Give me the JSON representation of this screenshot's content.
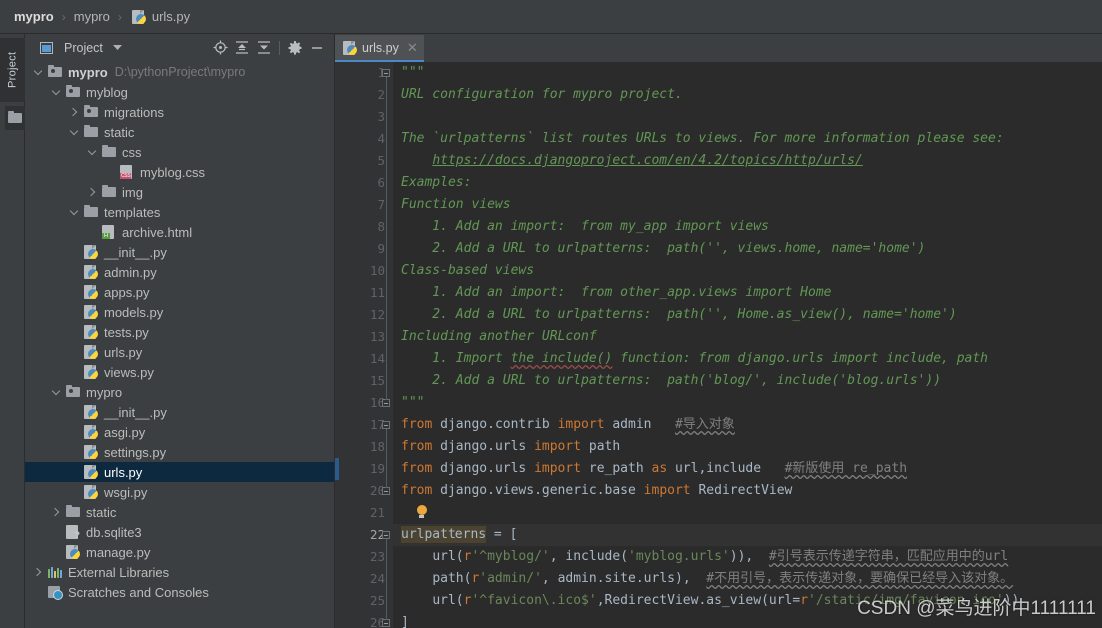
{
  "breadcrumb": {
    "items": [
      {
        "label": "mypro",
        "bold": true
      },
      {
        "label": "mypro",
        "bold": false
      },
      {
        "label": "urls.py",
        "bold": false,
        "icon": "python-file-icon"
      }
    ],
    "separator": "›"
  },
  "tool_strip": {
    "label": "Project",
    "icon": "project-folder-icon"
  },
  "project_panel": {
    "title": "Project",
    "dropdown_icon": "chevron-down-icon",
    "toolbar_icons": [
      "select-opened-file-icon",
      "expand-all-icon",
      "collapse-all-icon",
      "settings-gear-icon",
      "hide-panel-icon"
    ],
    "tree": [
      {
        "depth": 0,
        "arrow": "down",
        "icon": "folder-module-icon",
        "label": "mypro",
        "bold": true,
        "path": "D:\\pythonProject\\mypro",
        "selected": false
      },
      {
        "depth": 1,
        "arrow": "down",
        "icon": "folder-source-icon",
        "label": "myblog",
        "selected": false
      },
      {
        "depth": 2,
        "arrow": "right",
        "icon": "folder-source-icon",
        "label": "migrations",
        "selected": false
      },
      {
        "depth": 2,
        "arrow": "down",
        "icon": "folder-icon",
        "label": "static",
        "selected": false
      },
      {
        "depth": 3,
        "arrow": "down",
        "icon": "folder-icon",
        "label": "css",
        "selected": false
      },
      {
        "depth": 4,
        "arrow": "none",
        "icon": "css-file-icon",
        "label": "myblog.css",
        "selected": false
      },
      {
        "depth": 3,
        "arrow": "right",
        "icon": "folder-icon",
        "label": "img",
        "selected": false
      },
      {
        "depth": 2,
        "arrow": "down",
        "icon": "folder-icon",
        "label": "templates",
        "selected": false
      },
      {
        "depth": 3,
        "arrow": "none",
        "icon": "html-file-icon",
        "label": "archive.html",
        "selected": false
      },
      {
        "depth": 2,
        "arrow": "none",
        "icon": "python-file-icon",
        "label": "__init__.py",
        "selected": false
      },
      {
        "depth": 2,
        "arrow": "none",
        "icon": "python-file-icon",
        "label": "admin.py",
        "selected": false
      },
      {
        "depth": 2,
        "arrow": "none",
        "icon": "python-file-icon",
        "label": "apps.py",
        "selected": false
      },
      {
        "depth": 2,
        "arrow": "none",
        "icon": "python-file-icon",
        "label": "models.py",
        "selected": false
      },
      {
        "depth": 2,
        "arrow": "none",
        "icon": "python-file-icon",
        "label": "tests.py",
        "selected": false
      },
      {
        "depth": 2,
        "arrow": "none",
        "icon": "python-file-icon",
        "label": "urls.py",
        "selected": false
      },
      {
        "depth": 2,
        "arrow": "none",
        "icon": "python-file-icon",
        "label": "views.py",
        "selected": false
      },
      {
        "depth": 1,
        "arrow": "down",
        "icon": "folder-source-icon",
        "label": "mypro",
        "selected": false
      },
      {
        "depth": 2,
        "arrow": "none",
        "icon": "python-file-icon",
        "label": "__init__.py",
        "selected": false
      },
      {
        "depth": 2,
        "arrow": "none",
        "icon": "python-file-icon",
        "label": "asgi.py",
        "selected": false
      },
      {
        "depth": 2,
        "arrow": "none",
        "icon": "python-file-icon",
        "label": "settings.py",
        "selected": false
      },
      {
        "depth": 2,
        "arrow": "none",
        "icon": "python-file-icon",
        "label": "urls.py",
        "selected": true
      },
      {
        "depth": 2,
        "arrow": "none",
        "icon": "python-file-icon",
        "label": "wsgi.py",
        "selected": false
      },
      {
        "depth": 1,
        "arrow": "right",
        "icon": "folder-icon",
        "label": "static",
        "selected": false
      },
      {
        "depth": 1,
        "arrow": "none",
        "icon": "sqlite-file-icon",
        "label": "db.sqlite3",
        "selected": false
      },
      {
        "depth": 1,
        "arrow": "none",
        "icon": "python-file-icon",
        "label": "manage.py",
        "selected": false
      },
      {
        "depth": 0,
        "arrow": "right",
        "icon": "external-libraries-icon",
        "label": "External Libraries",
        "selected": false
      },
      {
        "depth": 0,
        "arrow": "none",
        "icon": "scratches-icon",
        "label": "Scratches and Consoles",
        "selected": false
      }
    ]
  },
  "editor": {
    "tabs": [
      {
        "label": "urls.py",
        "icon": "python-file-icon",
        "close_icon": "close-icon",
        "active": true
      }
    ],
    "caret_line": 22,
    "changed_lines": [
      19
    ],
    "lines": [
      {
        "n": 1,
        "text": "\"\"\""
      },
      {
        "n": 2,
        "text": "URL configuration for mypro project."
      },
      {
        "n": 3,
        "text": ""
      },
      {
        "n": 4,
        "text": "The `urlpatterns` list routes URLs to views. For more information please see:"
      },
      {
        "n": 5,
        "text": "    https://docs.djangoproject.com/en/4.2/topics/http/urls/"
      },
      {
        "n": 6,
        "text": "Examples:"
      },
      {
        "n": 7,
        "text": "Function views"
      },
      {
        "n": 8,
        "text": "    1. Add an import:  from my_app import views"
      },
      {
        "n": 9,
        "text": "    2. Add a URL to urlpatterns:  path('', views.home, name='home')"
      },
      {
        "n": 10,
        "text": "Class-based views"
      },
      {
        "n": 11,
        "text": "    1. Add an import:  from other_app.views import Home"
      },
      {
        "n": 12,
        "text": "    2. Add a URL to urlpatterns:  path('', Home.as_view(), name='home')"
      },
      {
        "n": 13,
        "text": "Including another URLconf"
      },
      {
        "n": 14,
        "text": "    1. Import the include() function: from django.urls import include, path"
      },
      {
        "n": 15,
        "text": "    2. Add a URL to urlpatterns:  path('blog/', include('blog.urls'))"
      },
      {
        "n": 16,
        "text": "\"\"\""
      },
      {
        "n": 17,
        "text": "from django.contrib import admin   #导入对象"
      },
      {
        "n": 18,
        "text": "from django.urls import path"
      },
      {
        "n": 19,
        "text": "from django.urls import re_path as url,include   #新版使用 re_path"
      },
      {
        "n": 20,
        "text": "from django.views.generic.base import RedirectView"
      },
      {
        "n": 21,
        "text": ""
      },
      {
        "n": 22,
        "text": "urlpatterns = ["
      },
      {
        "n": 23,
        "text": "    url(r'^myblog/', include('myblog.urls')),  #引号表示传递字符串，匹配应用中的url"
      },
      {
        "n": 24,
        "text": "    path(r'admin/', admin.site.urls),  #不用引号，表示传递对象，要确保已经导入该对象。"
      },
      {
        "n": 25,
        "text": "    url(r'^favicon\\.ico$',RedirectView.as_view(url=r'/static/img/favicon.ico'))"
      },
      {
        "n": 26,
        "text": "]"
      }
    ]
  },
  "watermark": {
    "text": "CSDN @菜鸟进阶中1111111"
  },
  "colors": {
    "background": "#3c3f41",
    "editor_background": "#2b2b2b",
    "gutter_background": "#313335",
    "selection": "#0d293f",
    "tab_underline": "#4a88c7",
    "keyword": "#cc7832",
    "string": "#6a8759",
    "comment": "#808080",
    "docstring": "#629755",
    "identifier": "#a9b7c6"
  }
}
